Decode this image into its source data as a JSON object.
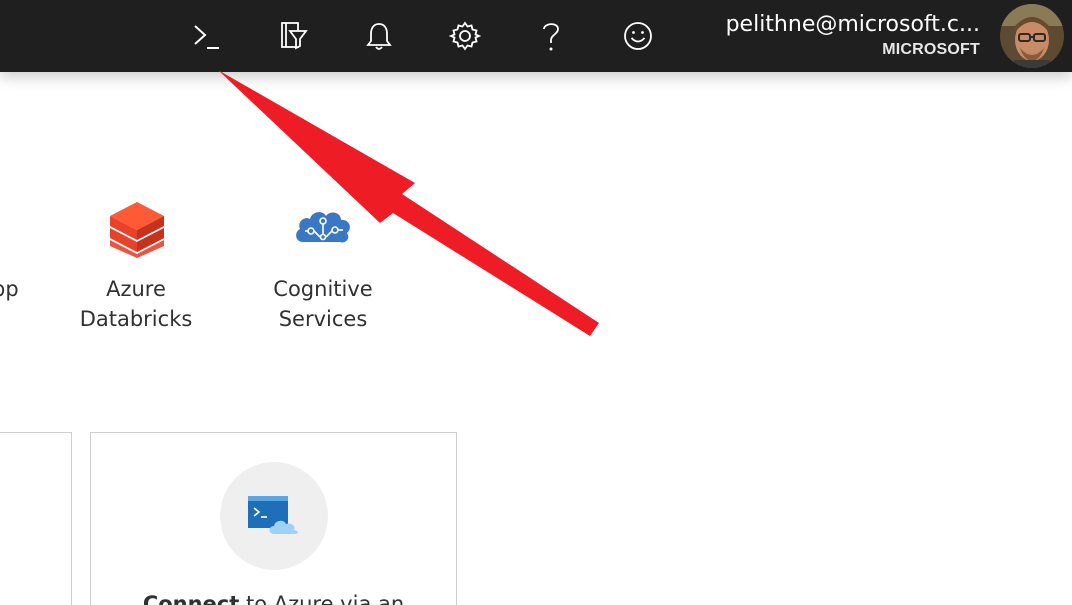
{
  "topbar": {
    "icons": [
      {
        "name": "cloud-shell-icon"
      },
      {
        "name": "directory-filter-icon"
      },
      {
        "name": "notifications-icon"
      },
      {
        "name": "settings-icon"
      },
      {
        "name": "help-icon"
      },
      {
        "name": "feedback-icon"
      }
    ],
    "account": {
      "email": "pelithne@microsoft.c...",
      "directory": "MICROSOFT"
    }
  },
  "services": [
    {
      "label_line1": "",
      "label_line2": "",
      "partial_label": "pp"
    },
    {
      "label_line1": "Azure",
      "label_line2": "Databricks",
      "icon": "databricks-icon"
    },
    {
      "label_line1": "Cognitive",
      "label_line2": "Services",
      "icon": "cognitive-services-icon"
    }
  ],
  "cards": [
    {
      "icon": "terminal-cloud-icon",
      "text_bold": "Connect",
      "text_rest": " to Azure via an"
    }
  ],
  "colors": {
    "topbar_bg": "#1f1f1f",
    "databricks": "#e8412c",
    "cognitive": "#3a78c3",
    "arrow": "#ee1c25"
  }
}
